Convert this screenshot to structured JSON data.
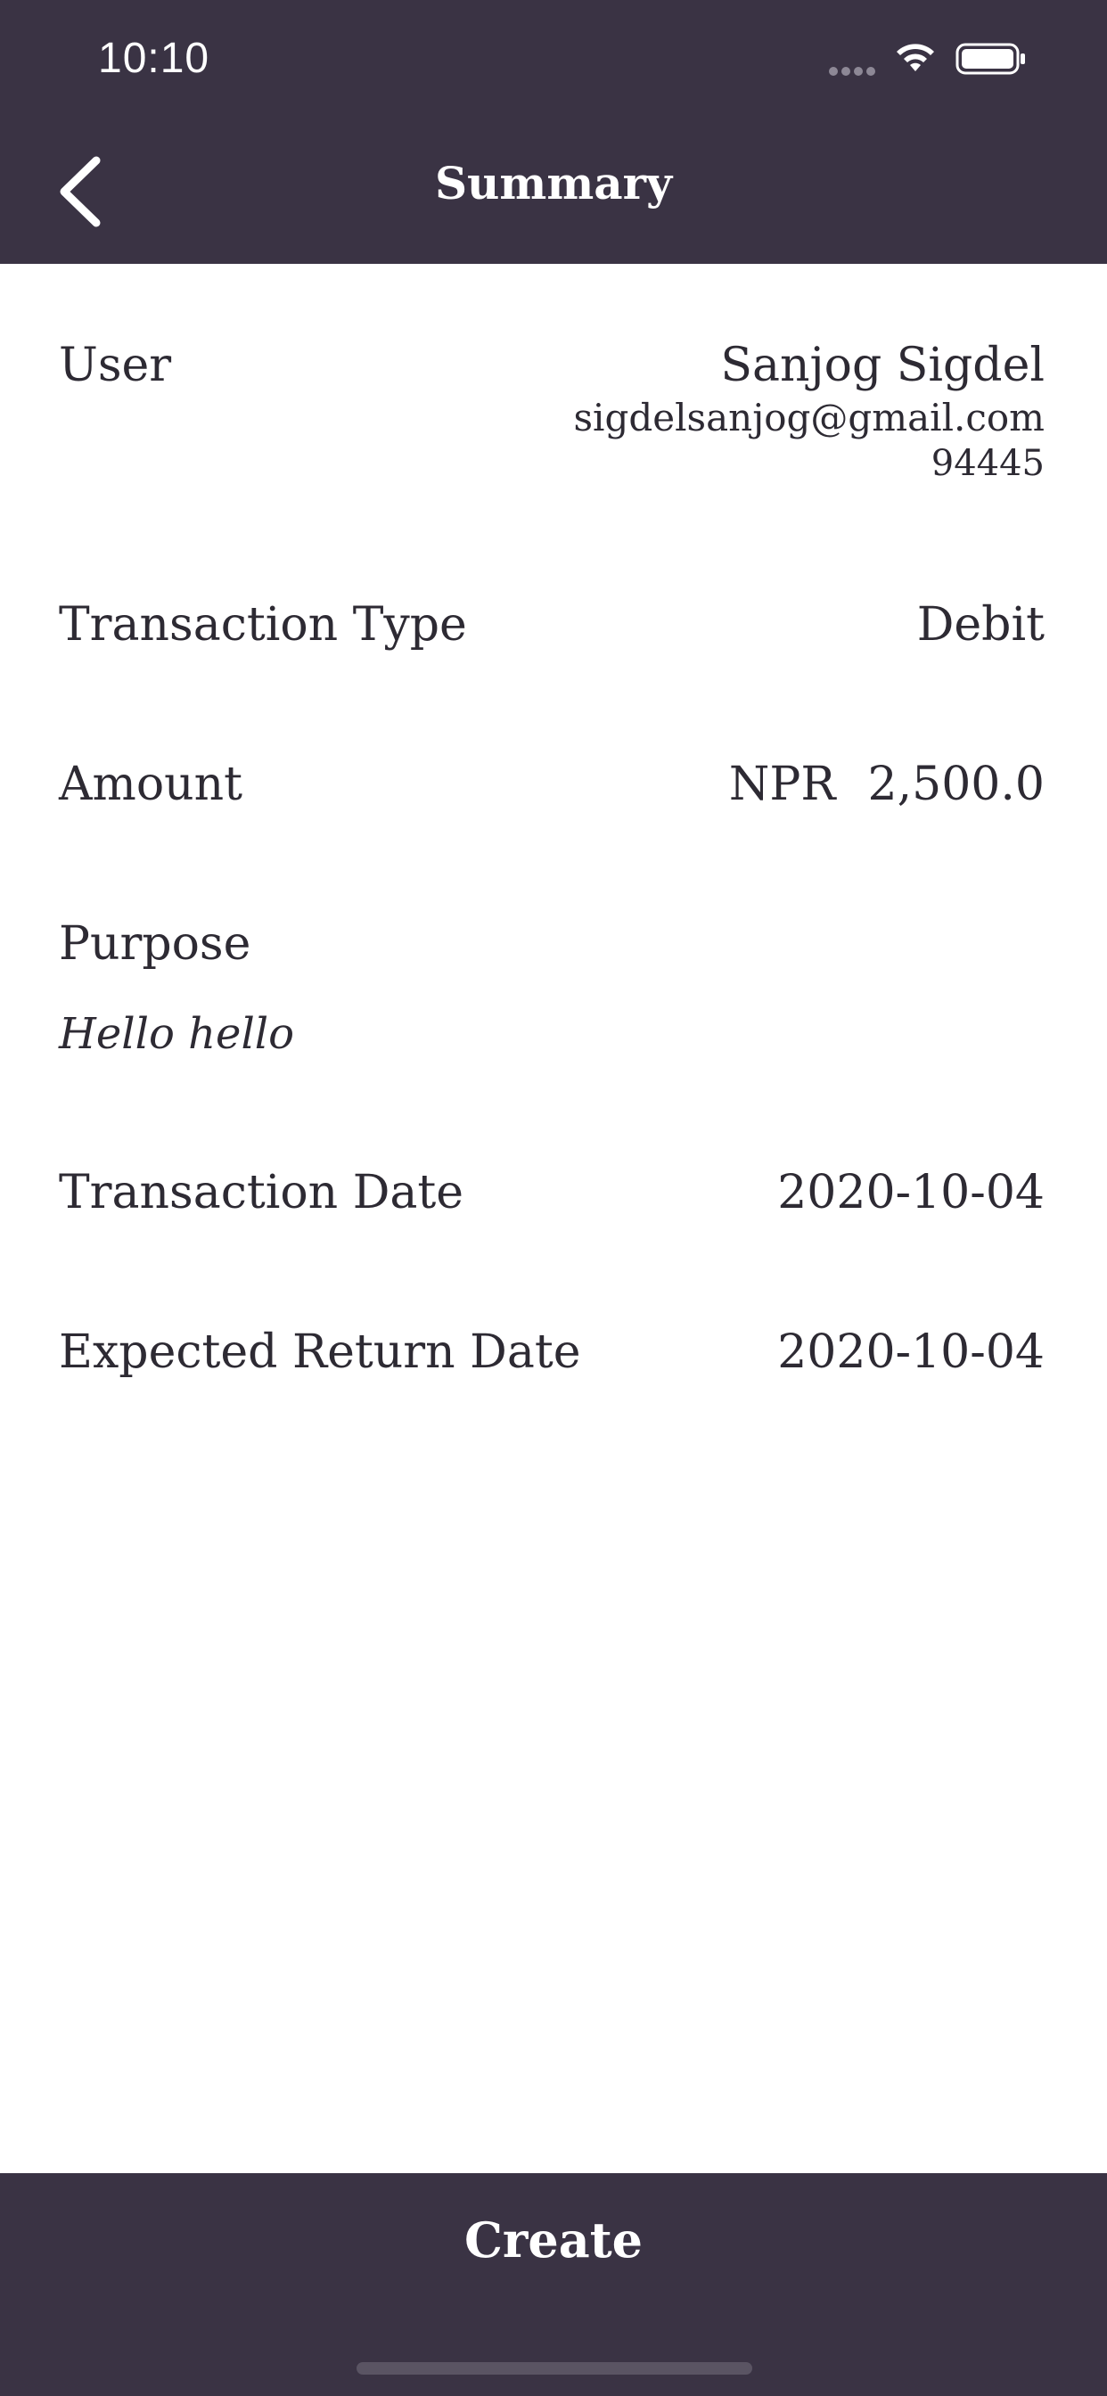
{
  "status_bar": {
    "time": "10:10"
  },
  "nav": {
    "title": "Summary",
    "back_icon": "chevron-left-icon"
  },
  "summary": {
    "user": {
      "label": "User",
      "name": "Sanjog Sigdel",
      "email": "sigdelsanjog@gmail.com",
      "phone": "94445"
    },
    "transaction_type": {
      "label": "Transaction Type",
      "value": "Debit"
    },
    "amount": {
      "label": "Amount",
      "currency": "NPR",
      "value": "2,500.0"
    },
    "purpose": {
      "label": "Purpose",
      "value": "Hello hello"
    },
    "transaction_date": {
      "label": "Transaction Date",
      "value": "2020-10-04"
    },
    "expected_return_date": {
      "label": "Expected Return Date",
      "value": "2020-10-04"
    }
  },
  "footer": {
    "create_label": "Create"
  },
  "colors": {
    "bar": "#3a3344",
    "text": "#2d2a33",
    "on_bar": "#ffffff"
  }
}
